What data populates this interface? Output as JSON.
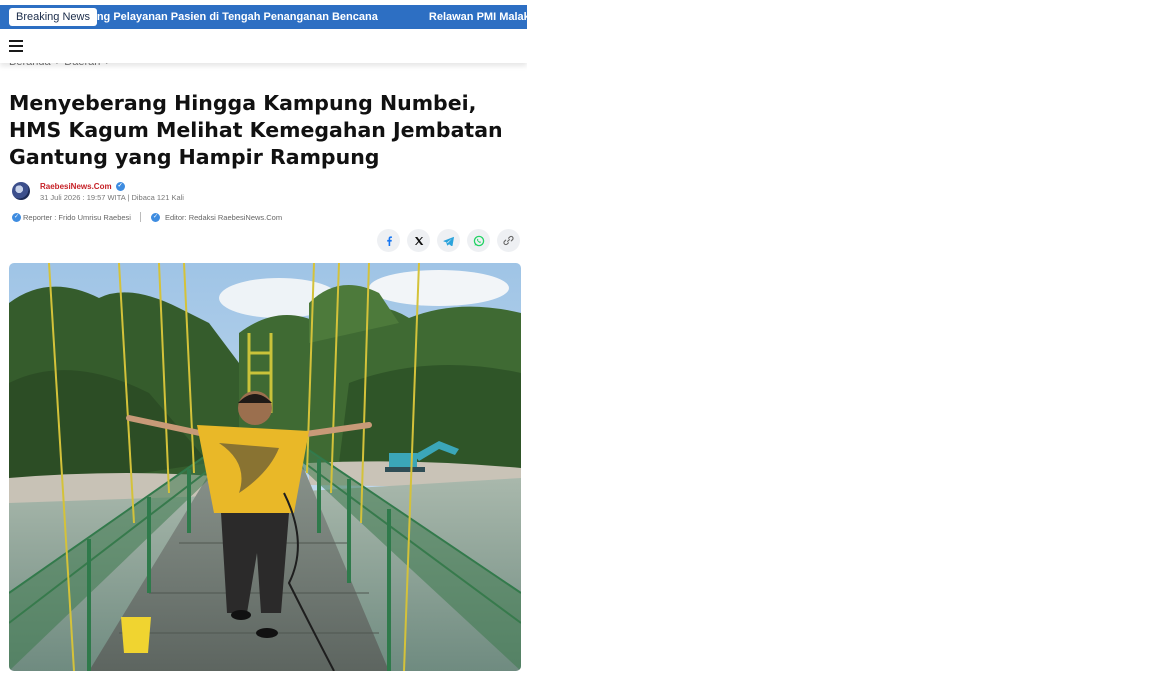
{
  "ticker": {
    "badge": "Breaking News",
    "items": [
      "kung Pelayanan Pasien di Tengah Penanganan Bencana",
      "Relawan PMI Malak"
    ]
  },
  "breadcrumb": {
    "items": [
      "Beranda",
      "Daerah"
    ]
  },
  "article": {
    "title": "Menyeberang Hingga Kampung Numbei, HMS Kagum Melihat Kemegahan Jembatan Gantung yang Hampir Rampung",
    "author": "RaebesiNews.Com",
    "dateline": "31 Juli 2026 : 19:57 WITA | Dibaca 121 Kali",
    "reporter": "Reporter : Frido Umrisu Raebesi",
    "editor": "Editor: Redaksi RaebesiNews.Com"
  },
  "share": {
    "icons": [
      "facebook-icon",
      "x-icon",
      "telegram-icon",
      "whatsapp-icon",
      "link-icon"
    ]
  },
  "colors": {
    "ticker_bg": "#2d6fc3",
    "author_red": "#c62127",
    "verified_blue": "#3e8ce0"
  }
}
